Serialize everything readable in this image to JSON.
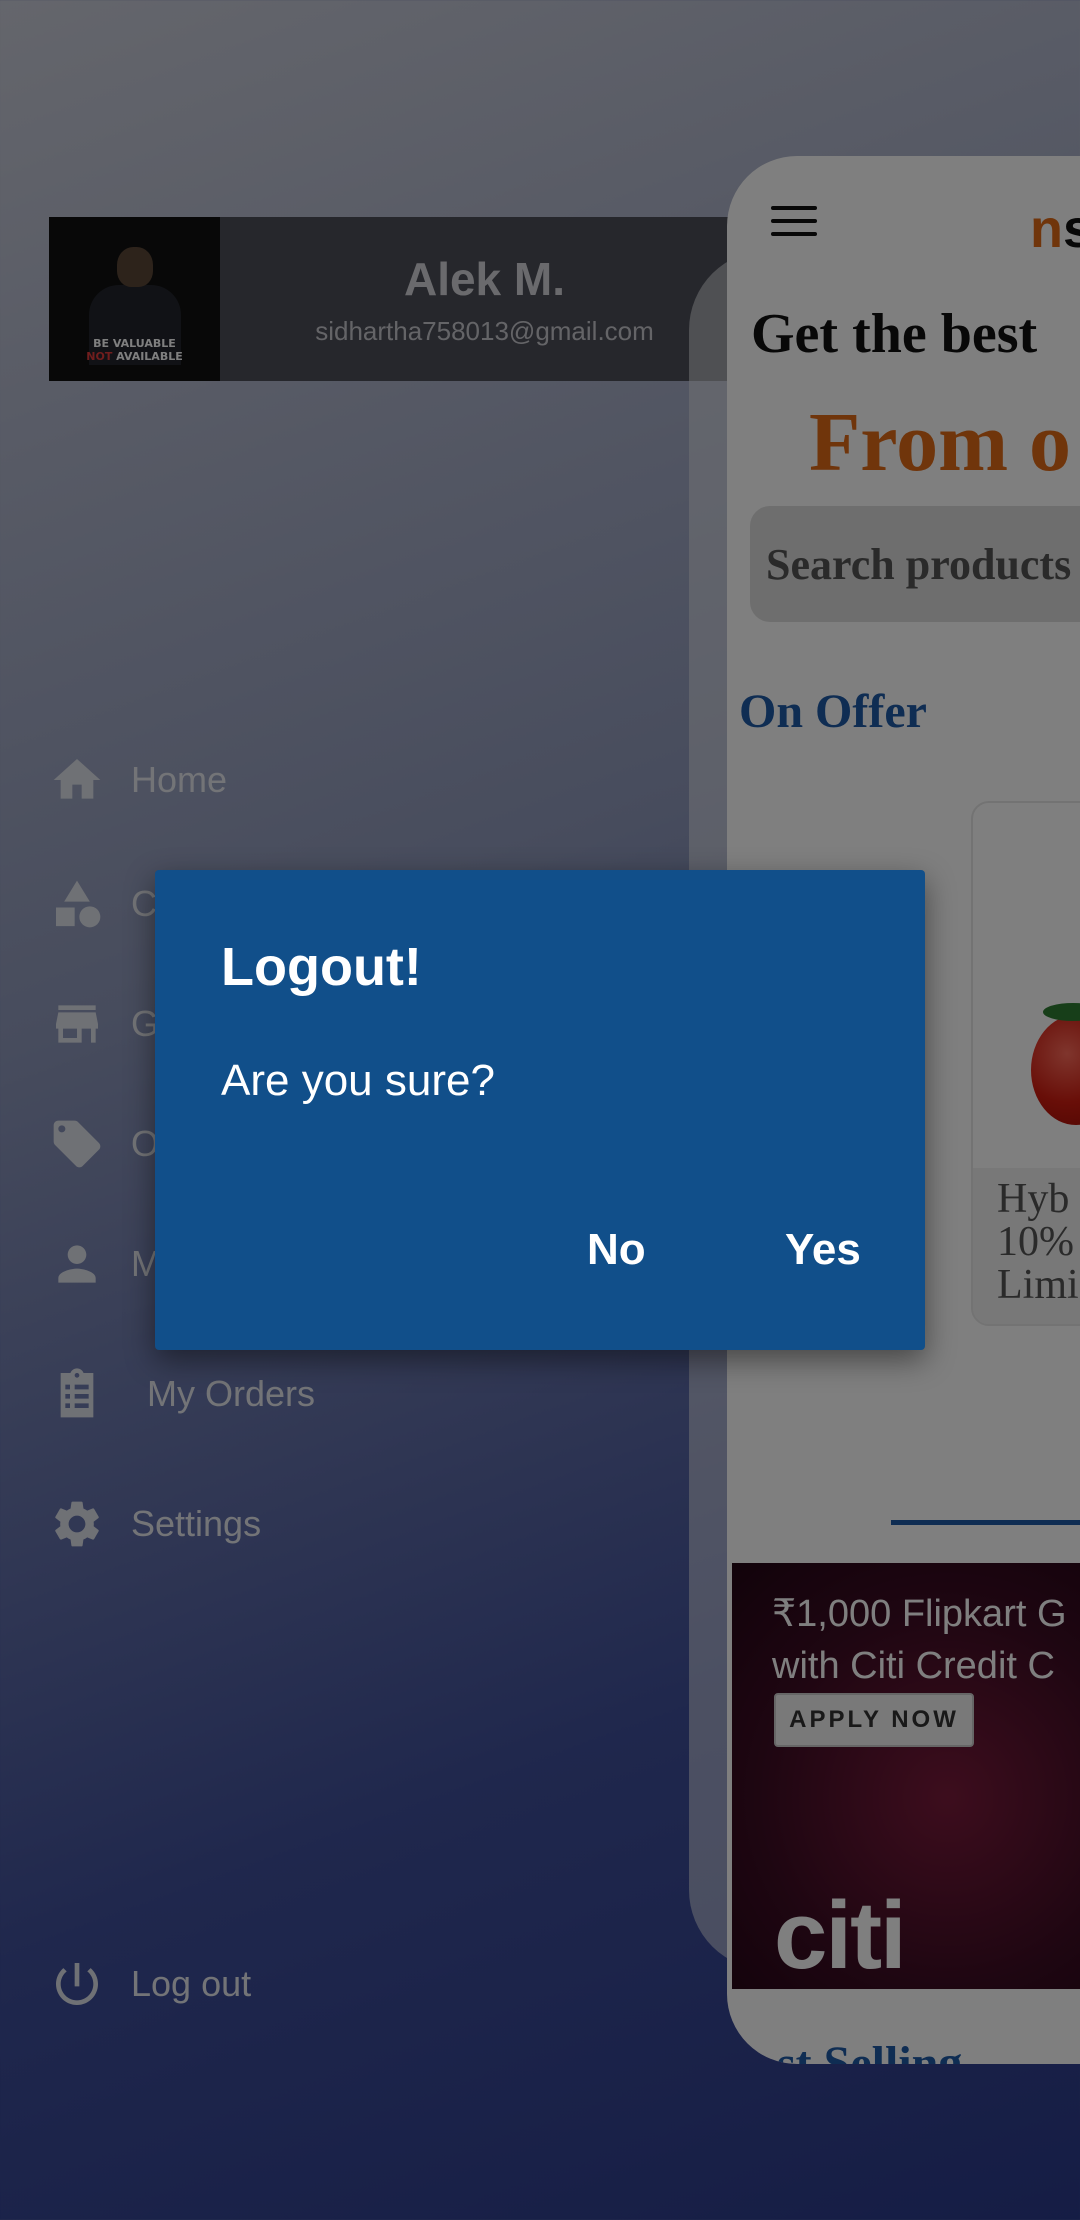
{
  "profile": {
    "name": "Alek M.",
    "email": "sidhartha758013@gmail.com",
    "avatar_text_line1": "BE VALUABLE",
    "avatar_text_line2_red": "NOT",
    "avatar_text_line2_white": " AVAILABLE"
  },
  "drawer": {
    "items": [
      {
        "label": "Home",
        "icon": "home-icon"
      },
      {
        "label": "C",
        "icon": "categories-icon"
      },
      {
        "label": "G",
        "icon": "store-icon"
      },
      {
        "label": "O",
        "icon": "tag-icon"
      },
      {
        "label": "M",
        "icon": "person-icon"
      },
      {
        "label": "My Orders",
        "icon": "clipboard-icon"
      },
      {
        "label": "Settings",
        "icon": "gear-icon"
      }
    ],
    "logout_label": "Log out"
  },
  "app": {
    "brand_part1": "n",
    "brand_part2": "s",
    "headline": "Get the best",
    "subline": "From o",
    "search_placeholder": "Search products",
    "section_offer": "On Offer",
    "offer_line1": "Hyb",
    "offer_line2": "10%",
    "offer_line3": "Limi",
    "banner_line1": "₹1,000 Flipkart G",
    "banner_line2": "with Citi Credit C",
    "banner_button": "APPLY NOW",
    "banner_logo": "citi",
    "section_best": "st Selling"
  },
  "dialog": {
    "title": "Logout!",
    "message": "Are you sure?",
    "no_label": "No",
    "yes_label": "Yes"
  },
  "colors": {
    "dialog_bg": "#114f8a",
    "accent_orange": "#e06a16",
    "accent_blue": "#1e5aa6"
  }
}
